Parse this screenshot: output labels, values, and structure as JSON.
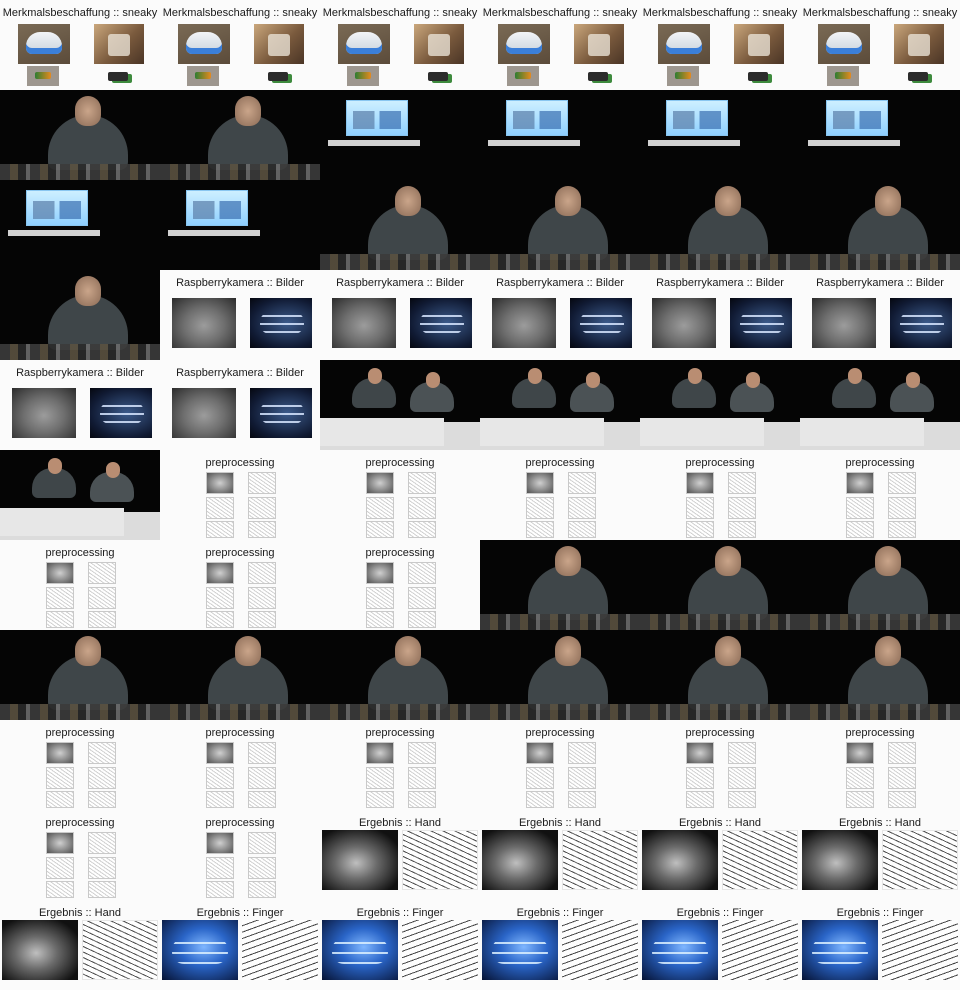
{
  "titles": {
    "sneaky": "Merkmalsbeschaffung :: sneaky",
    "raspberry": "Raspberrykamera :: Bilder",
    "preprocessing": "preprocessing",
    "hand": "Ergebnis :: Hand",
    "finger": "Ergebnis :: Finger"
  },
  "frames": [
    "sneaky",
    "sneaky",
    "sneaky",
    "sneaky",
    "sneaky",
    "sneaky",
    "speaker",
    "speaker",
    "screen",
    "screen",
    "screen",
    "screen",
    "screen",
    "screen",
    "speaker",
    "speaker",
    "speaker",
    "speaker",
    "speaker",
    "raspberry",
    "raspberry",
    "raspberry",
    "raspberry",
    "raspberry",
    "raspberry",
    "raspberry",
    "panel",
    "panel",
    "panel",
    "panel",
    "panel",
    "preprocessing",
    "preprocessing",
    "preprocessing",
    "preprocessing",
    "preprocessing",
    "preprocessing",
    "preprocessing",
    "preprocessing",
    "speaker",
    "speaker",
    "speaker",
    "speaker",
    "speaker",
    "speaker",
    "speaker",
    "speaker",
    "speaker",
    "preprocessing",
    "preprocessing",
    "preprocessing",
    "preprocessing",
    "preprocessing",
    "preprocessing",
    "preprocessing",
    "preprocessing",
    "hand",
    "hand",
    "hand",
    "hand",
    "hand",
    "finger",
    "finger",
    "finger",
    "finger",
    "finger"
  ]
}
